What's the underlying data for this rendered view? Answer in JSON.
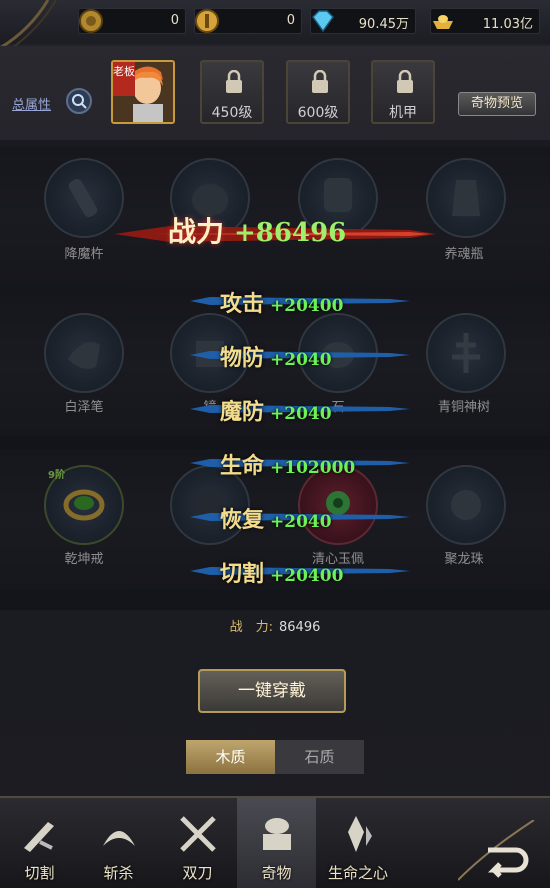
{
  "currencies": [
    {
      "value": "0",
      "icon": "coin-icon"
    },
    {
      "value": "0",
      "icon": "gold-coin-icon"
    },
    {
      "value": "90.45万",
      "icon": "diamond-icon"
    },
    {
      "value": "11.03亿",
      "icon": "gold-ingot-icon"
    }
  ],
  "header": {
    "total_attr": "总属性",
    "avatar_tag": "老板",
    "slots": [
      "450级",
      "600级",
      "机甲"
    ],
    "preview_label": "奇物预览"
  },
  "items": [
    {
      "name": "降魔杵",
      "icon": "pestle-icon"
    },
    {
      "name": "",
      "icon": "helmet-icon"
    },
    {
      "name": "",
      "icon": "ring-icon"
    },
    {
      "name": "养魂瓶",
      "icon": "vase-icon"
    },
    {
      "name": "白泽笔",
      "icon": "brush-icon"
    },
    {
      "name": "镜",
      "icon": "mirror-icon"
    },
    {
      "name": "石",
      "icon": "stone-icon"
    },
    {
      "name": "青铜神树",
      "icon": "bronze-tree-icon"
    },
    {
      "name": "乾坤戒",
      "icon": "jade-ring-icon",
      "grade": "9阶"
    },
    {
      "name": "",
      "icon": "dark-orb-icon"
    },
    {
      "name": "清心玉佩",
      "icon": "jade-pendant-icon"
    },
    {
      "name": "聚龙珠",
      "icon": "dragon-pearl-icon"
    }
  ],
  "popup": {
    "combat_label": "战力",
    "combat_value": "+86496",
    "attrs": [
      {
        "k": "攻击",
        "v": "+20400"
      },
      {
        "k": "物防",
        "v": "+2040"
      },
      {
        "k": "魔防",
        "v": "+2040"
      },
      {
        "k": "生命",
        "v": "+102000"
      },
      {
        "k": "恢复",
        "v": "+2040"
      },
      {
        "k": "切割",
        "v": "+20400"
      }
    ]
  },
  "combat_line": {
    "label": "战　力:",
    "value": "86496"
  },
  "wear_button": "一键穿戴",
  "tabs": {
    "active": "木质",
    "inactive": "石质"
  },
  "nav": [
    {
      "label": "切割",
      "icon": "cut-icon"
    },
    {
      "label": "斩杀",
      "icon": "slash-icon"
    },
    {
      "label": "双刀",
      "icon": "twin-blade-icon"
    },
    {
      "label": "奇物",
      "icon": "treasure-icon"
    },
    {
      "label": "生命之心",
      "icon": "life-heart-icon"
    }
  ],
  "colors": {
    "accent": "#c79a3b",
    "attr_value": "#6af256",
    "attr_key": "#f3dc8b",
    "combat_red": "#b4291d"
  }
}
